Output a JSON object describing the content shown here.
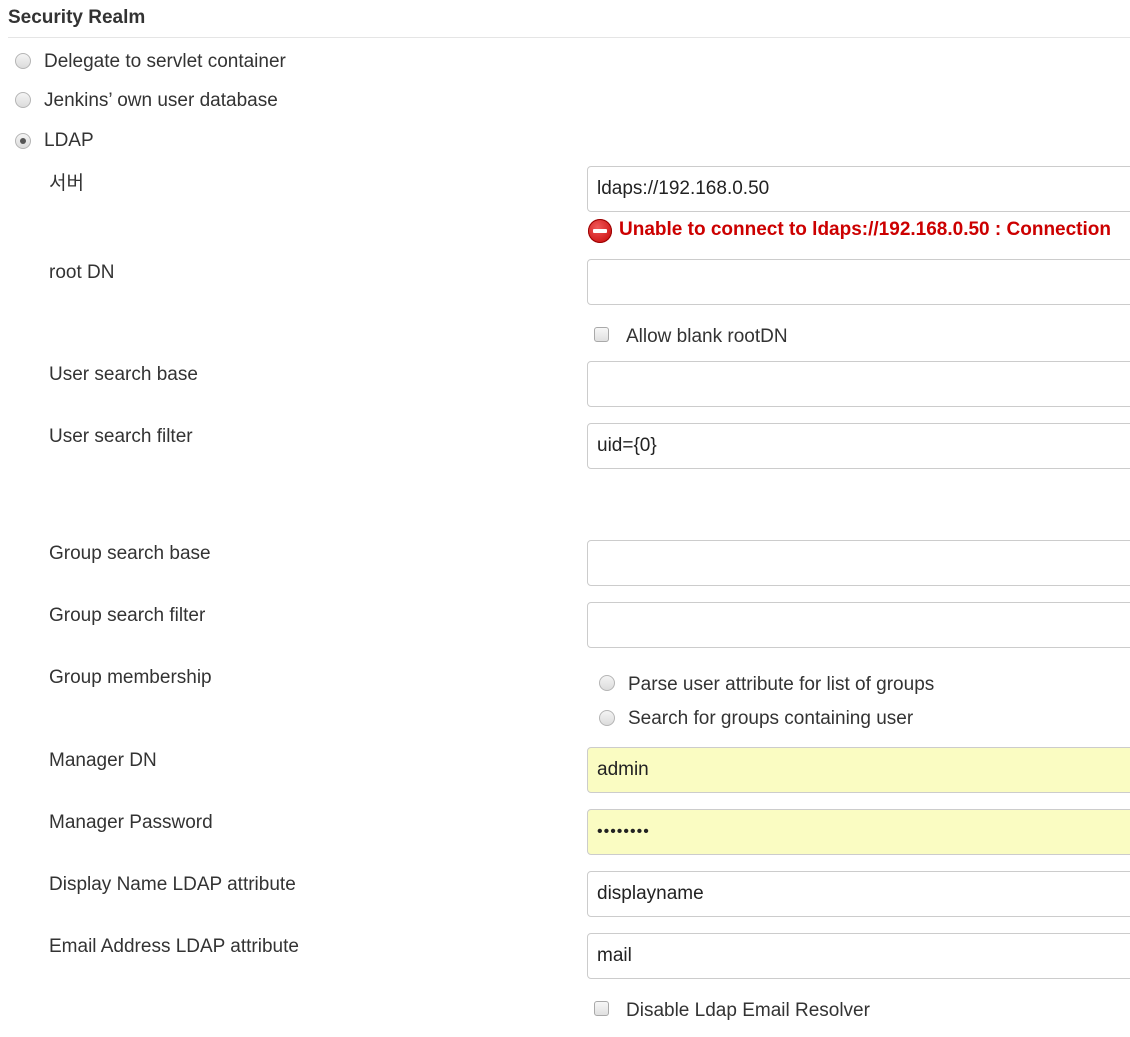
{
  "section_title": "Security Realm",
  "realm_options": [
    {
      "label": "Delegate to servlet container",
      "checked": false
    },
    {
      "label": "Jenkins’ own user database",
      "checked": false
    },
    {
      "label": "LDAP",
      "checked": true
    }
  ],
  "ldap": {
    "server": {
      "label": "서버",
      "value": "ldaps://192.168.0.50"
    },
    "server_error": "Unable to connect to ldaps://192.168.0.50 : Connection",
    "root_dn": {
      "label": "root DN",
      "value": ""
    },
    "allow_blank_root_dn": {
      "label": "Allow blank rootDN",
      "checked": false
    },
    "user_search_base": {
      "label": "User search base",
      "value": ""
    },
    "user_search_filter": {
      "label": "User search filter",
      "value": "uid={0}"
    },
    "group_search_base": {
      "label": "Group search base",
      "value": ""
    },
    "group_search_filter": {
      "label": "Group search filter",
      "value": ""
    },
    "group_membership": {
      "label": "Group membership",
      "options": [
        {
          "label": "Parse user attribute for list of groups",
          "checked": false
        },
        {
          "label": "Search for groups containing user",
          "checked": false
        }
      ]
    },
    "manager_dn": {
      "label": "Manager DN",
      "value": "admin"
    },
    "manager_password": {
      "label": "Manager Password",
      "value": "••••••••"
    },
    "display_name_attr": {
      "label": "Display Name LDAP attribute",
      "value": "displayname"
    },
    "email_attr": {
      "label": "Email Address LDAP attribute",
      "value": "mail"
    },
    "disable_email_resolver": {
      "label": "Disable Ldap Email Resolver",
      "checked": false
    }
  },
  "colors": {
    "error": "#cc0000",
    "autofill": "#fafcc2",
    "border": "#cccccc"
  }
}
